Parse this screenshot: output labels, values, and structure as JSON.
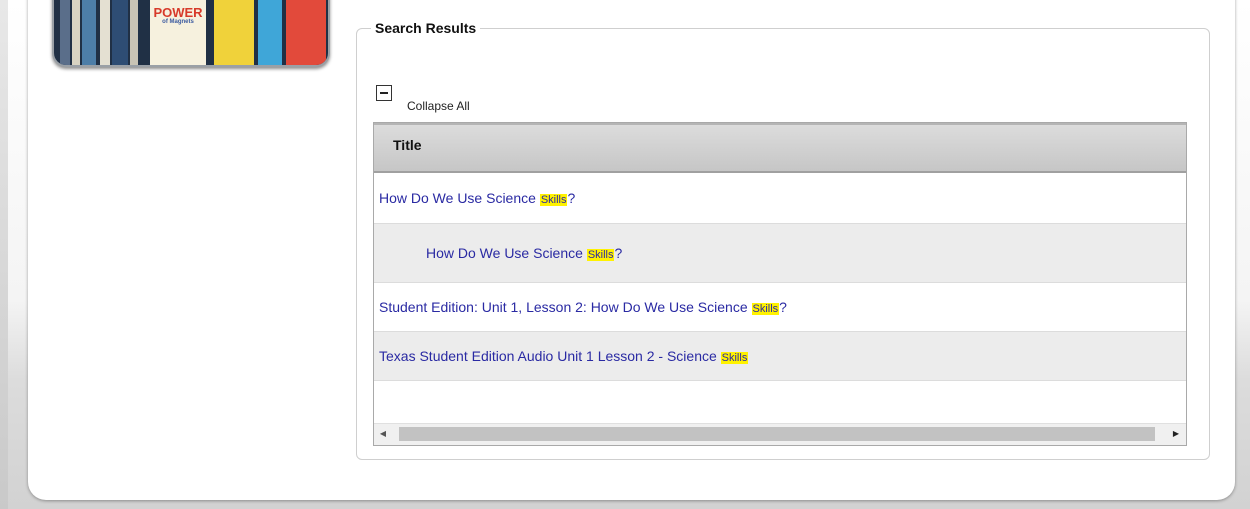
{
  "results": {
    "legend": "Search Results",
    "collapse_label": "Collapse All",
    "column_header": "Title",
    "highlight_term": "Skills",
    "rows": [
      {
        "before": "How Do We Use Science ",
        "after": "?"
      },
      {
        "before": "How Do We Use Science ",
        "after": "?"
      },
      {
        "before": "Student Edition: Unit 1, Lesson 2: How Do We Use Science ",
        "after": "?"
      },
      {
        "before": "Texas Student Edition Audio Unit 1 Lesson 2 - Science ",
        "after": ""
      }
    ]
  },
  "thumbnail": {
    "poster_title": "POWER",
    "poster_sub": "of Magnets"
  },
  "colors": {
    "link": "#2a2aa3",
    "highlight": "#fff200"
  }
}
